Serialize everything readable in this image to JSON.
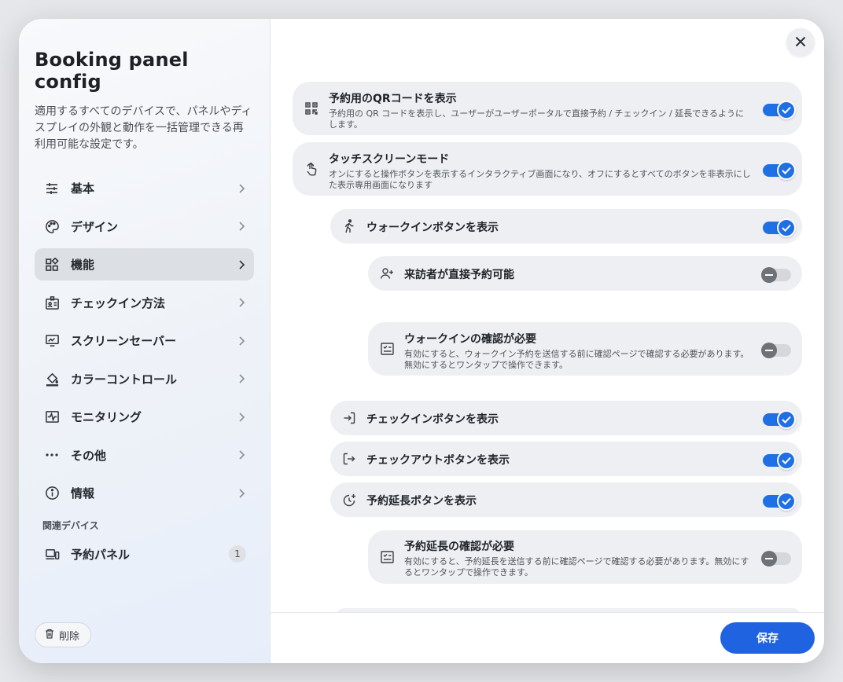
{
  "sidebar": {
    "title": "Booking panel config",
    "description": "適用するすべてのデバイスで、パネルやディスプレイの外観と動作を一括管理できる再利用可能な設定です。",
    "nav": [
      {
        "label": "基本",
        "icon": "sliders-icon"
      },
      {
        "label": "デザイン",
        "icon": "palette-icon"
      },
      {
        "label": "機能",
        "icon": "widgets-icon",
        "active": true
      },
      {
        "label": "チェックイン方法",
        "icon": "badge-icon"
      },
      {
        "label": "スクリーンセーバー",
        "icon": "monitor-icon"
      },
      {
        "label": "カラーコントロール",
        "icon": "paint-bucket-icon"
      },
      {
        "label": "モニタリング",
        "icon": "monitoring-icon"
      },
      {
        "label": "その他",
        "icon": "more-dots-icon"
      },
      {
        "label": "情報",
        "icon": "info-icon"
      }
    ],
    "related_section_label": "関連デバイス",
    "related_devices": [
      {
        "label": "予約パネル",
        "count": "1",
        "icon": "devices-icon"
      }
    ],
    "delete_label": "削除"
  },
  "settings": [
    {
      "title": "予約用のQRコードを表示",
      "desc1": "予約用の QR コードを表示し、ユーザーがユーザーポータルで直接予約 / チェックイン / 延長できるように",
      "desc2": "します。",
      "enabled": true,
      "icon": "qr-code-icon"
    },
    {
      "title": "タッチスクリーンモード",
      "desc1": "オンにすると操作ボタンを表示するインタラクティブ画面になり、オフにするとすべてのボタンを非表示にし",
      "desc2": "た表示専用画面になります",
      "enabled": true,
      "icon": "touch-icon"
    },
    {
      "title": "ウォークインボタンを表示",
      "enabled": true,
      "icon": "walk-icon"
    },
    {
      "title": "来訪者が直接予約可能",
      "enabled": false,
      "icon": "person-add-icon"
    },
    {
      "title": "ウォークインの確認が必要",
      "desc1": "有効にすると、ウォークイン予約を送信する前に確認ページで確認する必要があります。",
      "desc2": "無効にするとワンタップで操作できます。",
      "enabled": false,
      "icon": "checklist-icon"
    },
    {
      "title": "チェックインボタンを表示",
      "enabled": true,
      "icon": "login-icon"
    },
    {
      "title": "チェックアウトボタンを表示",
      "enabled": true,
      "icon": "logout-icon"
    },
    {
      "title": "予約延長ボタンを表示",
      "enabled": true,
      "icon": "clock-add-icon"
    },
    {
      "title": "予約延長の確認が必要",
      "desc1": "有効にすると、予約延長を送信する前に確認ページで確認する必要があります。無効にす",
      "desc2": "るとワンタップで操作できます。",
      "enabled": false,
      "icon": "checklist-icon"
    }
  ],
  "footer": {
    "save_label": "保存"
  },
  "colors": {
    "accent": "#1f63e0",
    "toggle_on": "#1f6fe5",
    "row_bg": "#edeff2"
  }
}
